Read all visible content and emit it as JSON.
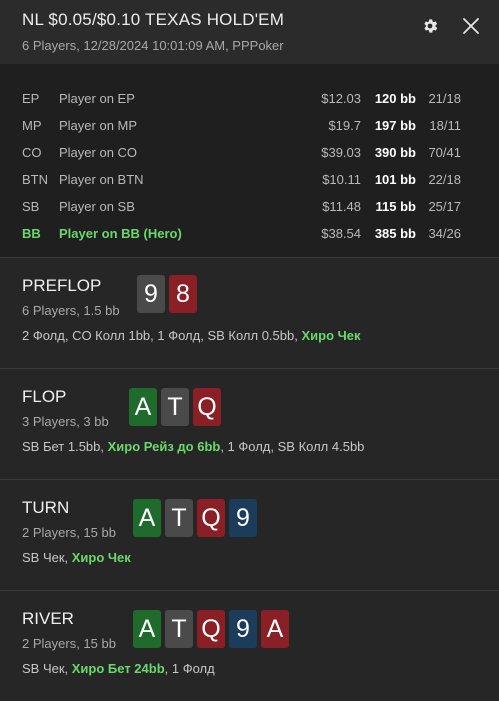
{
  "header": {
    "title": "NL $0.05/$0.10 TEXAS HOLD'EM",
    "subtitle": "6 Players, 12/28/2024 10:01:09 AM, PPPoker",
    "settings_icon": "gear-icon",
    "close_icon": "close-icon"
  },
  "players": [
    {
      "pos": "EP",
      "name": "Player on EP",
      "stack": "$12.03",
      "bb": "120 bb",
      "ratio": "21/18"
    },
    {
      "pos": "MP",
      "name": "Player on MP",
      "stack": "$19.7",
      "bb": "197 bb",
      "ratio": "18/11"
    },
    {
      "pos": "CO",
      "name": "Player on CO",
      "stack": "$39.03",
      "bb": "390 bb",
      "ratio": "70/41"
    },
    {
      "pos": "BTN",
      "name": "Player on BTN",
      "stack": "$10.11",
      "bb": "101 bb",
      "ratio": "22/18"
    },
    {
      "pos": "SB",
      "name": "Player on SB",
      "stack": "$11.48",
      "bb": "115 bb",
      "ratio": "25/17"
    },
    {
      "pos": "BB",
      "name": "Player on BB (Hero)",
      "stack": "$38.54",
      "bb": "385 bb",
      "ratio": "34/26"
    }
  ],
  "colors": {
    "hero": "#6bd86b",
    "spade": "#4a4a4a",
    "heart": "#8a1f25",
    "club": "#1f6b2b",
    "diamond": "#1b3c5a"
  },
  "streets": [
    {
      "name": "PREFLOP",
      "info": "6 Players, 1.5 bb",
      "cards": [
        {
          "rank": "9",
          "suit": "spade"
        },
        {
          "rank": "8",
          "suit": "heart"
        }
      ],
      "actions": {
        "plain": "2 Фолд, CO Колл 1bb, 1 Фолд, SB Колл 0.5bb, ",
        "hero": "Хиро Чек",
        "tail": ""
      }
    },
    {
      "name": "FLOP",
      "info": "3 Players, 3 bb",
      "cards": [
        {
          "rank": "A",
          "suit": "club"
        },
        {
          "rank": "T",
          "suit": "spade"
        },
        {
          "rank": "Q",
          "suit": "heart"
        }
      ],
      "actions": {
        "plain": "SB Бет 1.5bb, ",
        "hero": "Хиро Рейз до 6bb",
        "tail": ", 1 Фолд, SB Колл 4.5bb"
      }
    },
    {
      "name": "TURN",
      "info": "2 Players, 15 bb",
      "cards": [
        {
          "rank": "A",
          "suit": "club"
        },
        {
          "rank": "T",
          "suit": "spade"
        },
        {
          "rank": "Q",
          "suit": "heart"
        },
        {
          "rank": "9",
          "suit": "diamond"
        }
      ],
      "actions": {
        "plain": "SB Чек, ",
        "hero": "Хиро Чек",
        "tail": ""
      }
    },
    {
      "name": "RIVER",
      "info": "2 Players, 15 bb",
      "cards": [
        {
          "rank": "A",
          "suit": "club"
        },
        {
          "rank": "T",
          "suit": "spade"
        },
        {
          "rank": "Q",
          "suit": "heart"
        },
        {
          "rank": "9",
          "suit": "diamond"
        },
        {
          "rank": "A",
          "suit": "heart"
        }
      ],
      "actions": {
        "plain": "SB Чек, ",
        "hero": "Хиро Бет 24bb",
        "tail": ", 1 Фолд"
      }
    }
  ]
}
